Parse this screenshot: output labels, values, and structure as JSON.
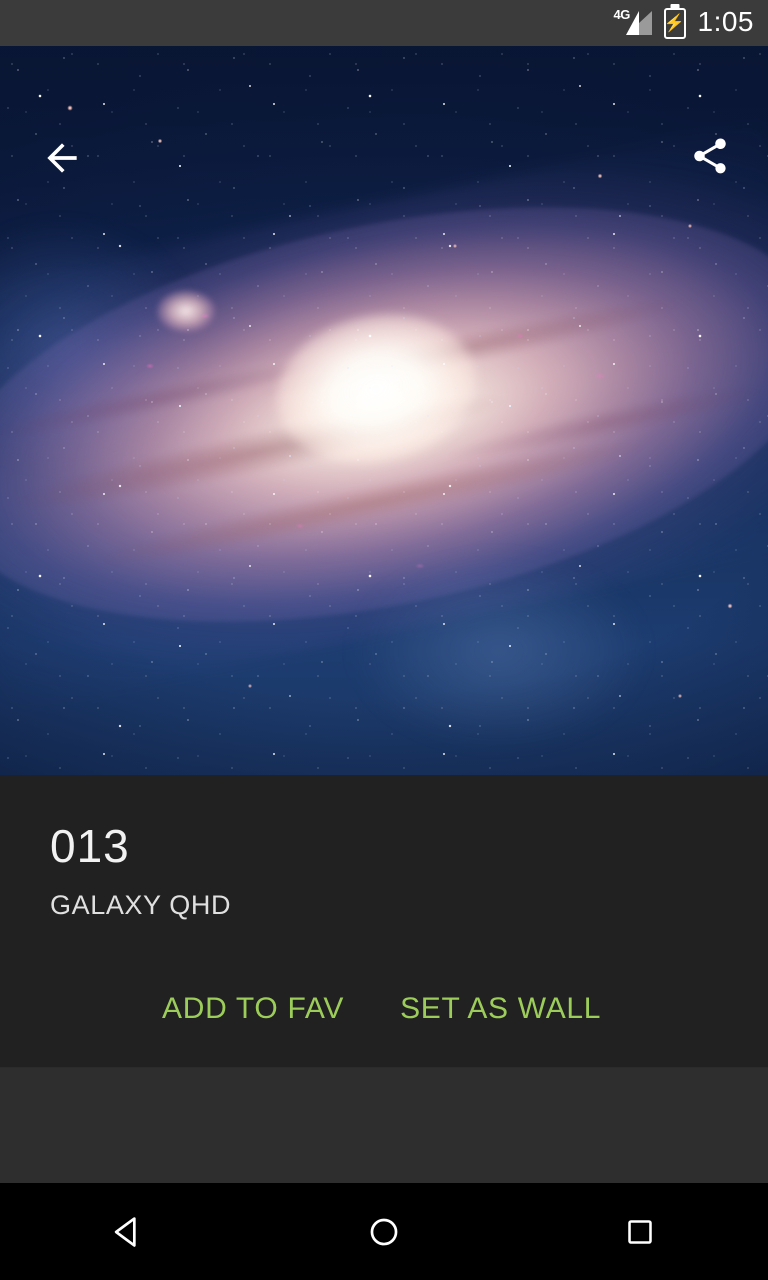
{
  "statusbar": {
    "network_label": "4G",
    "battery_icon": "battery-charging-icon",
    "signal_icon": "signal-4g-icon",
    "time": "1:05"
  },
  "hero": {
    "image_alt": "galaxy-wallpaper-preview",
    "back_icon": "arrow-back-icon",
    "share_icon": "share-icon"
  },
  "info": {
    "title": "013",
    "subtitle": "GALAXY QHD"
  },
  "actions": {
    "add_to_fav": "ADD TO FAV",
    "set_as_wall": "SET AS WALL",
    "accent_color": "#9CCC59"
  },
  "navbar": {
    "back": "back-triangle-icon",
    "home": "home-circle-icon",
    "recents": "recents-square-icon"
  },
  "colors": {
    "statusbar_bg": "#3B3B3B",
    "panel_bg": "#212121",
    "page_bg": "#2E2E2E",
    "navbar_bg": "#000000",
    "title_text": "#F2F2F2",
    "accent_green": "#9CCC59"
  }
}
